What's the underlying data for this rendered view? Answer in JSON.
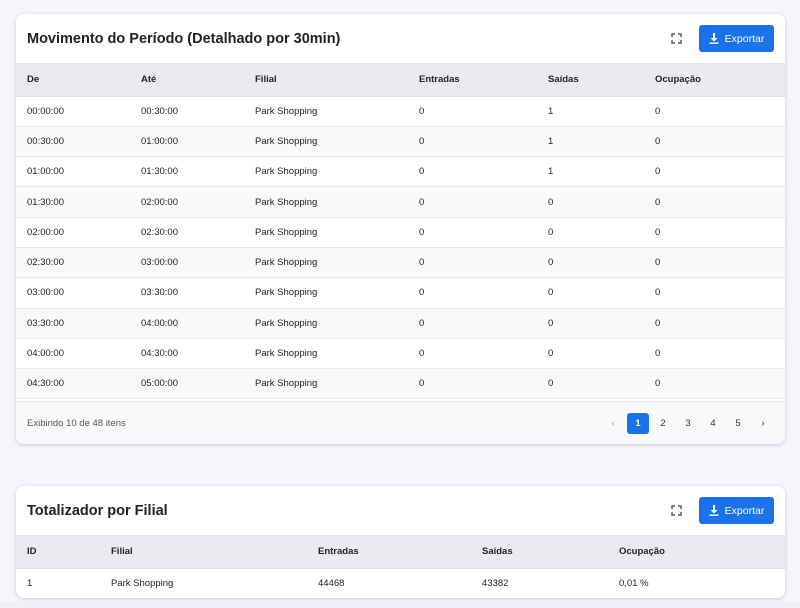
{
  "card1": {
    "title": "Movimento do Período (Detalhado por 30min)",
    "export_label": "Exportar",
    "columns": [
      "De",
      "Até",
      "Filial",
      "Entradas",
      "Saídas",
      "Ocupação"
    ],
    "rows": [
      [
        "00:00:00",
        "00:30:00",
        "Park Shopping",
        "0",
        "1",
        "0"
      ],
      [
        "00:30:00",
        "01:00:00",
        "Park Shopping",
        "0",
        "1",
        "0"
      ],
      [
        "01:00:00",
        "01:30:00",
        "Park Shopping",
        "0",
        "1",
        "0"
      ],
      [
        "01:30:00",
        "02:00:00",
        "Park Shopping",
        "0",
        "0",
        "0"
      ],
      [
        "02:00:00",
        "02:30:00",
        "Park Shopping",
        "0",
        "0",
        "0"
      ],
      [
        "02:30:00",
        "03:00:00",
        "Park Shopping",
        "0",
        "0",
        "0"
      ],
      [
        "03:00:00",
        "03:30:00",
        "Park Shopping",
        "0",
        "0",
        "0"
      ],
      [
        "03:30:00",
        "04:00:00",
        "Park Shopping",
        "0",
        "0",
        "0"
      ],
      [
        "04:00:00",
        "04:30:00",
        "Park Shopping",
        "0",
        "0",
        "0"
      ],
      [
        "04:30:00",
        "05:00:00",
        "Park Shopping",
        "0",
        "0",
        "0"
      ]
    ],
    "footer_info": "Exibindo 10 de 48 itens",
    "pages": [
      "1",
      "2",
      "3",
      "4",
      "5"
    ],
    "active_page": "1",
    "prev_glyph": "‹",
    "next_glyph": "›"
  },
  "card2": {
    "title": "Totalizador por Filial",
    "export_label": "Exportar",
    "columns": [
      "ID",
      "Filial",
      "Entradas",
      "Saídas",
      "Ocupação"
    ],
    "rows": [
      [
        "1",
        "Park Shopping",
        "44468",
        "43382",
        "0,01 %"
      ]
    ]
  },
  "icons": {
    "expand": "expand-icon",
    "download": "download-icon"
  },
  "colors": {
    "accent": "#1a73e8",
    "header_bg": "#e9ebef"
  }
}
